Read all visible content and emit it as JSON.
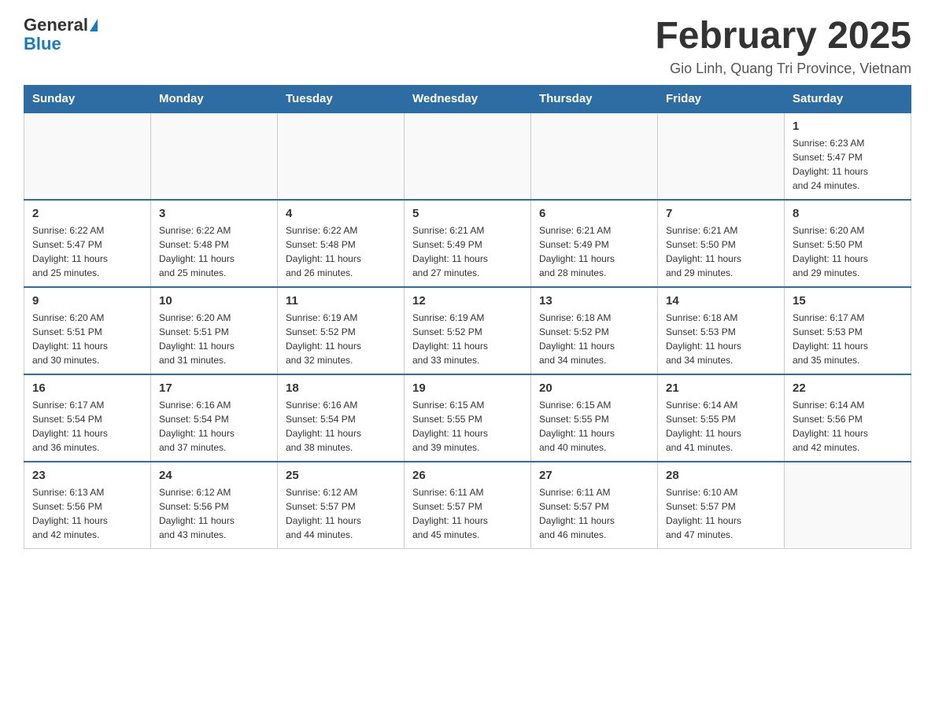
{
  "header": {
    "logo_general": "General",
    "logo_blue": "Blue",
    "title": "February 2025",
    "location": "Gio Linh, Quang Tri Province, Vietnam"
  },
  "days_of_week": [
    "Sunday",
    "Monday",
    "Tuesday",
    "Wednesday",
    "Thursday",
    "Friday",
    "Saturday"
  ],
  "weeks": [
    [
      {
        "day": "",
        "info": ""
      },
      {
        "day": "",
        "info": ""
      },
      {
        "day": "",
        "info": ""
      },
      {
        "day": "",
        "info": ""
      },
      {
        "day": "",
        "info": ""
      },
      {
        "day": "",
        "info": ""
      },
      {
        "day": "1",
        "info": "Sunrise: 6:23 AM\nSunset: 5:47 PM\nDaylight: 11 hours\nand 24 minutes."
      }
    ],
    [
      {
        "day": "2",
        "info": "Sunrise: 6:22 AM\nSunset: 5:47 PM\nDaylight: 11 hours\nand 25 minutes."
      },
      {
        "day": "3",
        "info": "Sunrise: 6:22 AM\nSunset: 5:48 PM\nDaylight: 11 hours\nand 25 minutes."
      },
      {
        "day": "4",
        "info": "Sunrise: 6:22 AM\nSunset: 5:48 PM\nDaylight: 11 hours\nand 26 minutes."
      },
      {
        "day": "5",
        "info": "Sunrise: 6:21 AM\nSunset: 5:49 PM\nDaylight: 11 hours\nand 27 minutes."
      },
      {
        "day": "6",
        "info": "Sunrise: 6:21 AM\nSunset: 5:49 PM\nDaylight: 11 hours\nand 28 minutes."
      },
      {
        "day": "7",
        "info": "Sunrise: 6:21 AM\nSunset: 5:50 PM\nDaylight: 11 hours\nand 29 minutes."
      },
      {
        "day": "8",
        "info": "Sunrise: 6:20 AM\nSunset: 5:50 PM\nDaylight: 11 hours\nand 29 minutes."
      }
    ],
    [
      {
        "day": "9",
        "info": "Sunrise: 6:20 AM\nSunset: 5:51 PM\nDaylight: 11 hours\nand 30 minutes."
      },
      {
        "day": "10",
        "info": "Sunrise: 6:20 AM\nSunset: 5:51 PM\nDaylight: 11 hours\nand 31 minutes."
      },
      {
        "day": "11",
        "info": "Sunrise: 6:19 AM\nSunset: 5:52 PM\nDaylight: 11 hours\nand 32 minutes."
      },
      {
        "day": "12",
        "info": "Sunrise: 6:19 AM\nSunset: 5:52 PM\nDaylight: 11 hours\nand 33 minutes."
      },
      {
        "day": "13",
        "info": "Sunrise: 6:18 AM\nSunset: 5:52 PM\nDaylight: 11 hours\nand 34 minutes."
      },
      {
        "day": "14",
        "info": "Sunrise: 6:18 AM\nSunset: 5:53 PM\nDaylight: 11 hours\nand 34 minutes."
      },
      {
        "day": "15",
        "info": "Sunrise: 6:17 AM\nSunset: 5:53 PM\nDaylight: 11 hours\nand 35 minutes."
      }
    ],
    [
      {
        "day": "16",
        "info": "Sunrise: 6:17 AM\nSunset: 5:54 PM\nDaylight: 11 hours\nand 36 minutes."
      },
      {
        "day": "17",
        "info": "Sunrise: 6:16 AM\nSunset: 5:54 PM\nDaylight: 11 hours\nand 37 minutes."
      },
      {
        "day": "18",
        "info": "Sunrise: 6:16 AM\nSunset: 5:54 PM\nDaylight: 11 hours\nand 38 minutes."
      },
      {
        "day": "19",
        "info": "Sunrise: 6:15 AM\nSunset: 5:55 PM\nDaylight: 11 hours\nand 39 minutes."
      },
      {
        "day": "20",
        "info": "Sunrise: 6:15 AM\nSunset: 5:55 PM\nDaylight: 11 hours\nand 40 minutes."
      },
      {
        "day": "21",
        "info": "Sunrise: 6:14 AM\nSunset: 5:55 PM\nDaylight: 11 hours\nand 41 minutes."
      },
      {
        "day": "22",
        "info": "Sunrise: 6:14 AM\nSunset: 5:56 PM\nDaylight: 11 hours\nand 42 minutes."
      }
    ],
    [
      {
        "day": "23",
        "info": "Sunrise: 6:13 AM\nSunset: 5:56 PM\nDaylight: 11 hours\nand 42 minutes."
      },
      {
        "day": "24",
        "info": "Sunrise: 6:12 AM\nSunset: 5:56 PM\nDaylight: 11 hours\nand 43 minutes."
      },
      {
        "day": "25",
        "info": "Sunrise: 6:12 AM\nSunset: 5:57 PM\nDaylight: 11 hours\nand 44 minutes."
      },
      {
        "day": "26",
        "info": "Sunrise: 6:11 AM\nSunset: 5:57 PM\nDaylight: 11 hours\nand 45 minutes."
      },
      {
        "day": "27",
        "info": "Sunrise: 6:11 AM\nSunset: 5:57 PM\nDaylight: 11 hours\nand 46 minutes."
      },
      {
        "day": "28",
        "info": "Sunrise: 6:10 AM\nSunset: 5:57 PM\nDaylight: 11 hours\nand 47 minutes."
      },
      {
        "day": "",
        "info": ""
      }
    ]
  ]
}
